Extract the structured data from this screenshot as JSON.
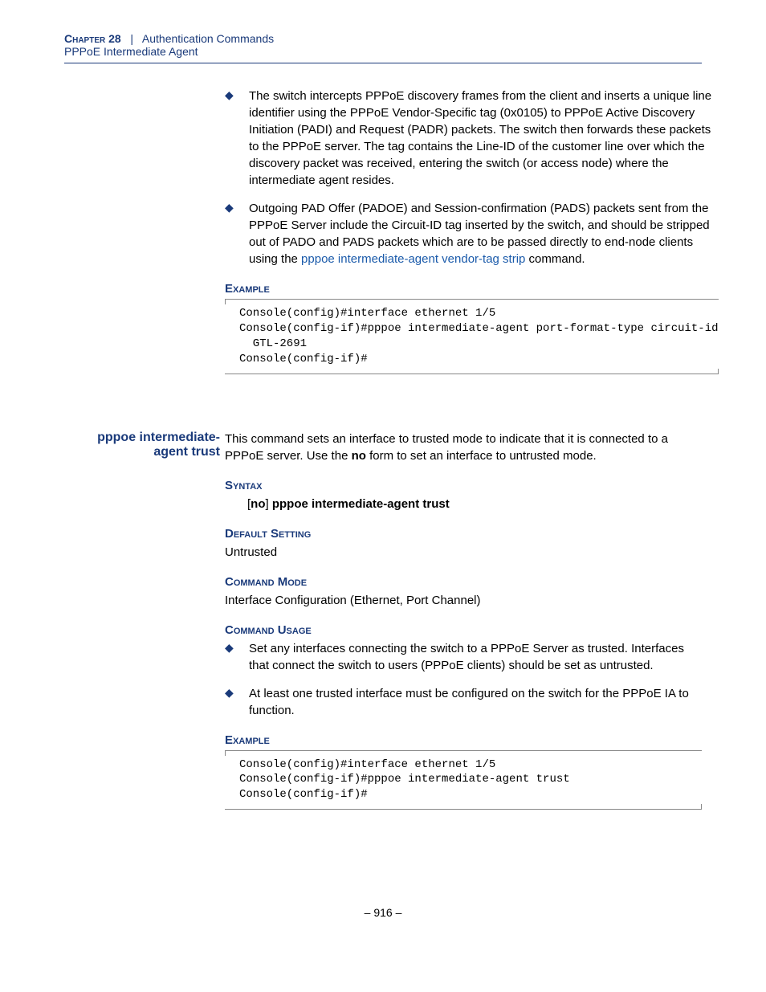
{
  "header": {
    "chapter_label": "Chapter 28",
    "separator": "|",
    "chapter_title": "Authentication Commands",
    "subtitle": "PPPoE Intermediate Agent"
  },
  "section1": {
    "bullets": [
      {
        "text": "The switch intercepts PPPoE discovery frames from the client and inserts a unique line identifier using the PPPoE Vendor-Specific tag (0x0105) to PPPoE Active Discovery Initiation (PADI) and Request (PADR) packets. The switch then forwards these packets to the PPPoE server. The tag contains the Line-ID of the customer line over which the discovery packet was received, entering the switch (or access node) where the intermediate agent resides."
      },
      {
        "pre_text": "Outgoing PAD Offer (PADOE) and Session-confirmation (PADS) packets sent from the PPPoE Server include the Circuit-ID tag inserted by the switch, and should be stripped out of PADO and PADS packets which are to be passed directly to end-node clients using the ",
        "link_text": "pppoe intermediate-agent vendor-tag strip",
        "post_text": " command."
      }
    ],
    "example_label": "Example",
    "code": "Console(config)#interface ethernet 1/5\nConsole(config-if)#pppoe intermediate-agent port-format-type circuit-id\n  GTL-2691\nConsole(config-if)#"
  },
  "section2": {
    "sidebar_heading": "pppoe intermediate-agent trust",
    "intro_pre": "This command sets an interface to trusted mode to indicate that it is connected to a PPPoE server. Use the ",
    "intro_bold": "no",
    "intro_post": " form to set an interface to untrusted mode.",
    "syntax_label": "Syntax",
    "syntax_bracket_open": "[",
    "syntax_no": "no",
    "syntax_bracket_close": "] ",
    "syntax_cmd": "pppoe intermediate-agent trust",
    "default_label": "Default Setting",
    "default_value": "Untrusted",
    "mode_label": "Command Mode",
    "mode_value": "Interface Configuration (Ethernet, Port Channel)",
    "usage_label": "Command Usage",
    "usage_bullets": [
      "Set any interfaces connecting the switch to a PPPoE Server as trusted. Interfaces that connect the switch to users (PPPoE clients) should be set as untrusted.",
      "At least one trusted interface must be configured on the switch for the PPPoE IA to function."
    ],
    "example_label": "Example",
    "code": "Console(config)#interface ethernet 1/5\nConsole(config-if)#pppoe intermediate-agent trust\nConsole(config-if)#"
  },
  "page_number": "–  916  –"
}
